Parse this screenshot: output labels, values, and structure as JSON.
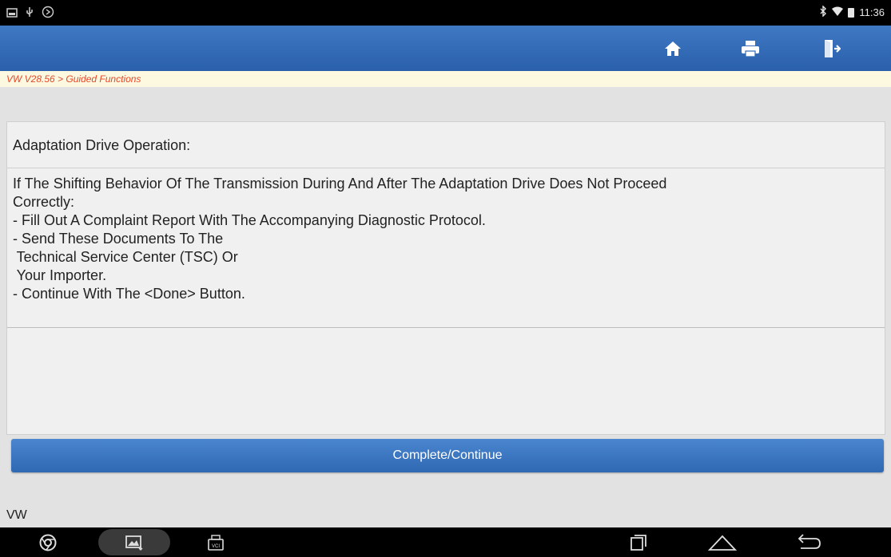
{
  "status_bar": {
    "left_icons": [
      "notification-icon",
      "usb-icon",
      "sync-icon"
    ],
    "time": "11:36"
  },
  "toolbar": {
    "buttons": [
      "home-icon",
      "print-icon",
      "exit-icon"
    ]
  },
  "breadcrumb": "VW V28.56 > Guided Functions",
  "panel": {
    "title": "Adaptation Drive Operation:",
    "lines": [
      "If The Shifting Behavior Of The Transmission During And After The Adaptation Drive Does Not Proceed",
      "Correctly:",
      "- Fill Out A Complaint Report With The Accompanying Diagnostic Protocol.",
      "- Send These Documents To The",
      " Technical Service Center (TSC) Or",
      " Your Importer.",
      "- Continue With The <Done> Button."
    ]
  },
  "action_button": "Complete/Continue",
  "footer_label": "VW",
  "nav_bar": {
    "vci_label": "VCI",
    "items": [
      "chrome-icon",
      "gallery-icon",
      "vci-icon",
      "recent-apps-icon",
      "home-icon",
      "back-icon"
    ]
  },
  "colors": {
    "toolbar": "#2f68b3",
    "breadcrumb_text": "#e8482a",
    "breadcrumb_bg": "#fdf8e0",
    "button": "#3a78c4"
  }
}
